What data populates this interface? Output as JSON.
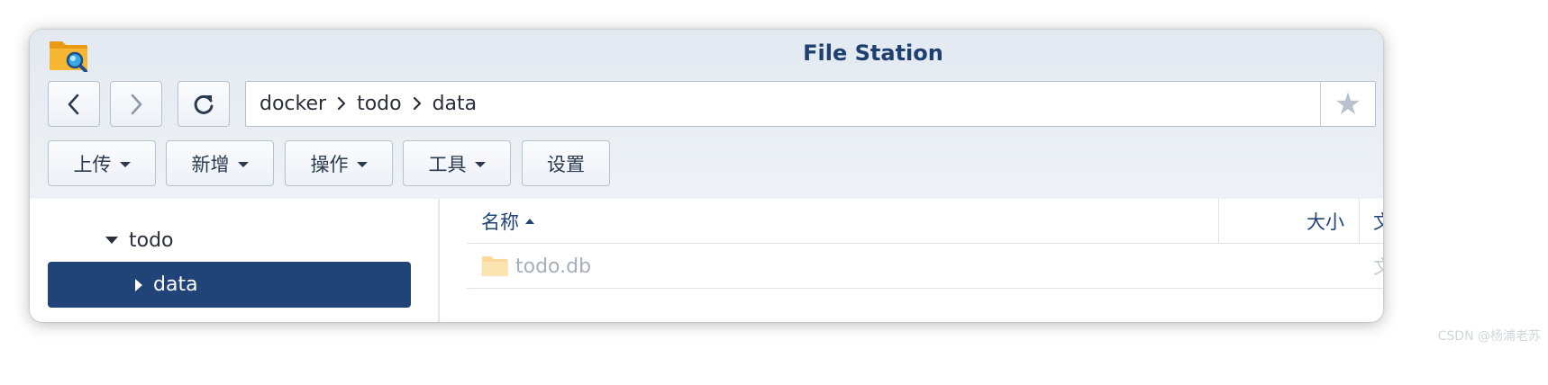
{
  "window": {
    "title": "File Station"
  },
  "navigation": {
    "back_icon": "chevron-left-icon",
    "forward_icon": "chevron-right-icon",
    "refresh_icon": "refresh-icon"
  },
  "path": {
    "crumbs": [
      "docker",
      "todo",
      "data"
    ],
    "separator_icon": "chevron-right-icon",
    "favorite_icon": "star-icon"
  },
  "toolbar": {
    "upload_label": "上传",
    "new_label": "新增",
    "action_label": "操作",
    "tools_label": "工具",
    "settings_label": "设置"
  },
  "tree": {
    "parent_label": "todo",
    "selected_label": "data"
  },
  "table": {
    "columns": {
      "name": "名称",
      "size": "大小",
      "type": "文"
    },
    "rows": [
      {
        "name": "todo.db",
        "type": "文",
        "icon": "folder-icon"
      }
    ]
  },
  "colors": {
    "title": "#1e3f6f",
    "selection": "#214478",
    "header_text": "#214478"
  },
  "watermark": "CSDN @杨浦老苏"
}
